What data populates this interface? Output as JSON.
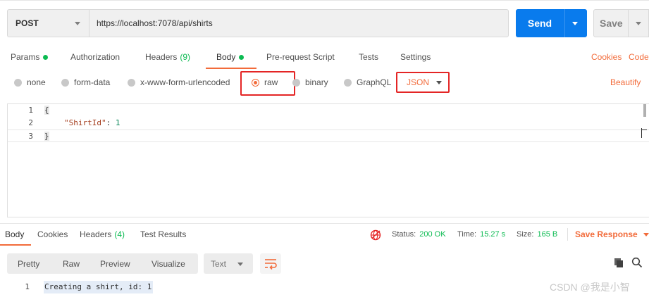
{
  "request": {
    "method": "POST",
    "url": "https://localhost:7078/api/shirts",
    "send_label": "Send",
    "save_label": "Save"
  },
  "tabs": [
    {
      "label": "Params",
      "dot": true
    },
    {
      "label": "Authorization"
    },
    {
      "label": "Headers",
      "count": "(9)"
    },
    {
      "label": "Body",
      "dot": true,
      "active": true
    },
    {
      "label": "Pre-request Script"
    },
    {
      "label": "Tests"
    },
    {
      "label": "Settings"
    }
  ],
  "right_links": {
    "cookies": "Cookies",
    "code": "Code"
  },
  "body_types": [
    {
      "label": "none"
    },
    {
      "label": "form-data"
    },
    {
      "label": "x-www-form-urlencoded"
    },
    {
      "label": "raw",
      "selected": true
    },
    {
      "label": "binary"
    },
    {
      "label": "GraphQL"
    }
  ],
  "format_select": "JSON",
  "beautify": "Beautify",
  "editor": {
    "line_numbers": [
      "1",
      "2",
      "3"
    ],
    "line1": "{",
    "line2_key": "\"ShirtId\"",
    "line2_sep": ": ",
    "line2_value": "1",
    "line3": "}"
  },
  "response": {
    "tabs": [
      {
        "label": "Body",
        "active": true
      },
      {
        "label": "Cookies"
      },
      {
        "label": "Headers",
        "count": "(4)"
      },
      {
        "label": "Test Results"
      }
    ],
    "status_label": "Status:",
    "status_value": "200 OK",
    "time_label": "Time:",
    "time_value": "15.27 s",
    "size_label": "Size:",
    "size_value": "165 B",
    "save_response": "Save Response",
    "view_modes": [
      "Pretty",
      "Raw",
      "Preview",
      "Visualize"
    ],
    "text_select": "Text",
    "line_number": "1",
    "body_text": "Creating a shirt, id: 1"
  },
  "watermark": "CSDN @我是小智",
  "colors": {
    "accent": "#f26b3a",
    "send_blue": "#097bed",
    "success": "#0cbb52",
    "highlight_box": "#e42525"
  }
}
